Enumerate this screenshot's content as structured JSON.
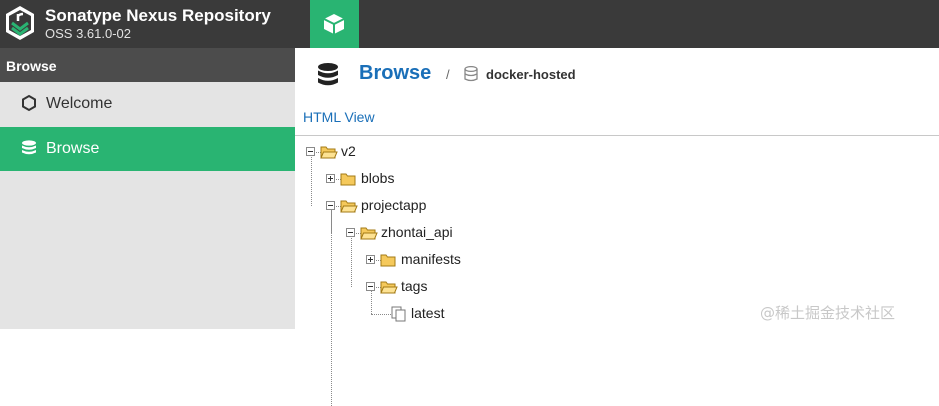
{
  "header": {
    "title": "Sonatype Nexus Repository",
    "version": "OSS 3.61.0-02",
    "logo_icon": "nexus-logo-icon",
    "mode_icon": "cube-icon"
  },
  "sidebar": {
    "title": "Browse",
    "items": [
      {
        "label": "Welcome",
        "icon": "hexagon-icon",
        "selected": false
      },
      {
        "label": "Browse",
        "icon": "database-icon",
        "selected": true
      }
    ]
  },
  "breadcrumb": {
    "title": "Browse",
    "separator": "/",
    "repository": "docker-hosted"
  },
  "html_view": "HTML View",
  "tree": [
    {
      "label": "v2",
      "depth": 0,
      "expanded": true,
      "type": "folder"
    },
    {
      "label": "blobs",
      "depth": 1,
      "expanded": false,
      "type": "folder"
    },
    {
      "label": "projectapp",
      "depth": 1,
      "expanded": true,
      "type": "folder"
    },
    {
      "label": "zhontai_api",
      "depth": 2,
      "expanded": true,
      "type": "folder"
    },
    {
      "label": "manifests",
      "depth": 3,
      "expanded": false,
      "type": "folder"
    },
    {
      "label": "tags",
      "depth": 3,
      "expanded": true,
      "type": "folder"
    },
    {
      "label": "latest",
      "depth": 4,
      "type": "file"
    }
  ],
  "watermark": "@稀土掘金技术社区",
  "colors": {
    "accent_green": "#29b472",
    "topbar": "#3a3a3a",
    "link_blue": "#1a6fb8",
    "folder_yellow": "#f5c95c"
  }
}
